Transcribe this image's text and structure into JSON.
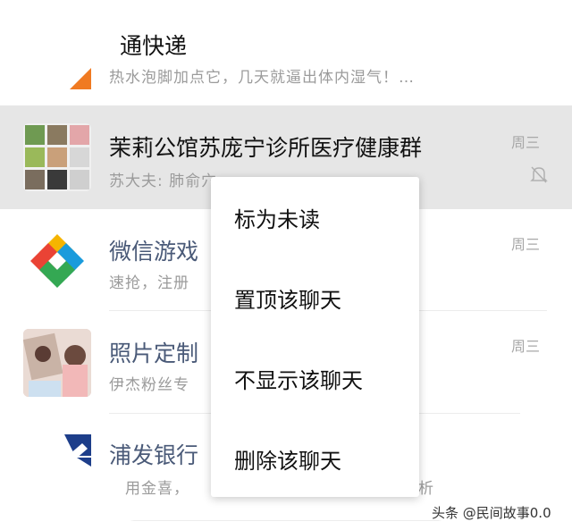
{
  "chats": [
    {
      "name": "chat-express",
      "title": "通快递",
      "preview": "热水泡脚加点它，几天就逼出体内湿气！…"
    },
    {
      "name": "chat-clinic-group",
      "title": "茉莉公馆苏庞宁诊所医疗健康群",
      "preview": "苏大夫: 肺俞穴",
      "time": "周三",
      "avatar_icon": "group-collage-icon"
    },
    {
      "name": "chat-wechat-games",
      "title": "微信游戏",
      "preview": "速抢，注册",
      "time": "周三",
      "avatar_icon": "wechat-games-logo-icon"
    },
    {
      "name": "chat-photo-print",
      "title": "照片定制",
      "preview": "伊杰粉丝专",
      "time": "周三",
      "avatar_icon": "photo-avatar-icon"
    },
    {
      "name": "chat-spdb",
      "title": "浦发银行",
      "preview": "用金喜，",
      "avatar_icon": "spdb-logo-icon"
    }
  ],
  "preview_tail": "析",
  "context_menu": {
    "items": [
      {
        "label": "标为未读"
      },
      {
        "label": "置顶该聊天"
      },
      {
        "label": "不显示该聊天"
      },
      {
        "label": "删除该聊天"
      }
    ]
  },
  "watermark": "头条 @民间故事0.0",
  "colors": {
    "highlight": "#e6e6e6",
    "title_text": "#111111",
    "link_title": "#4a5a78",
    "preview_text": "#9b9b9b"
  }
}
